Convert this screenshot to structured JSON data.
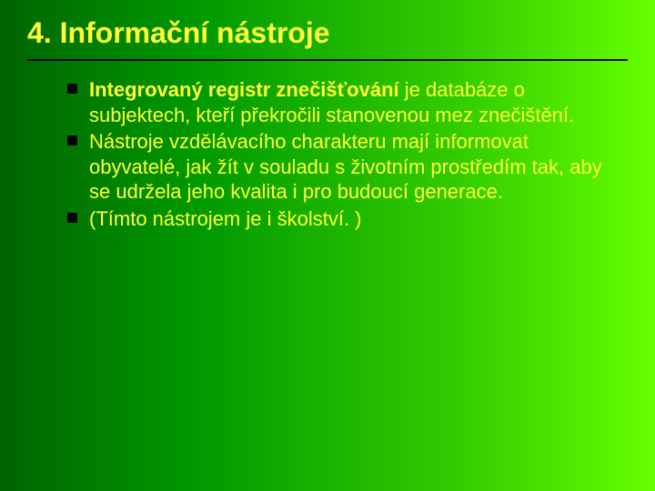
{
  "slide": {
    "title": "4. Informační nástroje",
    "bullets": [
      {
        "lead": "Integrovaný registr znečišťování",
        "rest": " je databáze o subjektech, kteří překročili stanovenou mez znečištění."
      },
      {
        "lead": "",
        "rest": "Nástroje vzdělávacího charakteru mají informovat obyvatelé, jak žít v souladu s životním prostředím tak, aby se udržela jeho kvalita i pro budoucí generace."
      },
      {
        "lead": "",
        "rest": "(Tímto nástrojem je i školství. )"
      }
    ]
  }
}
